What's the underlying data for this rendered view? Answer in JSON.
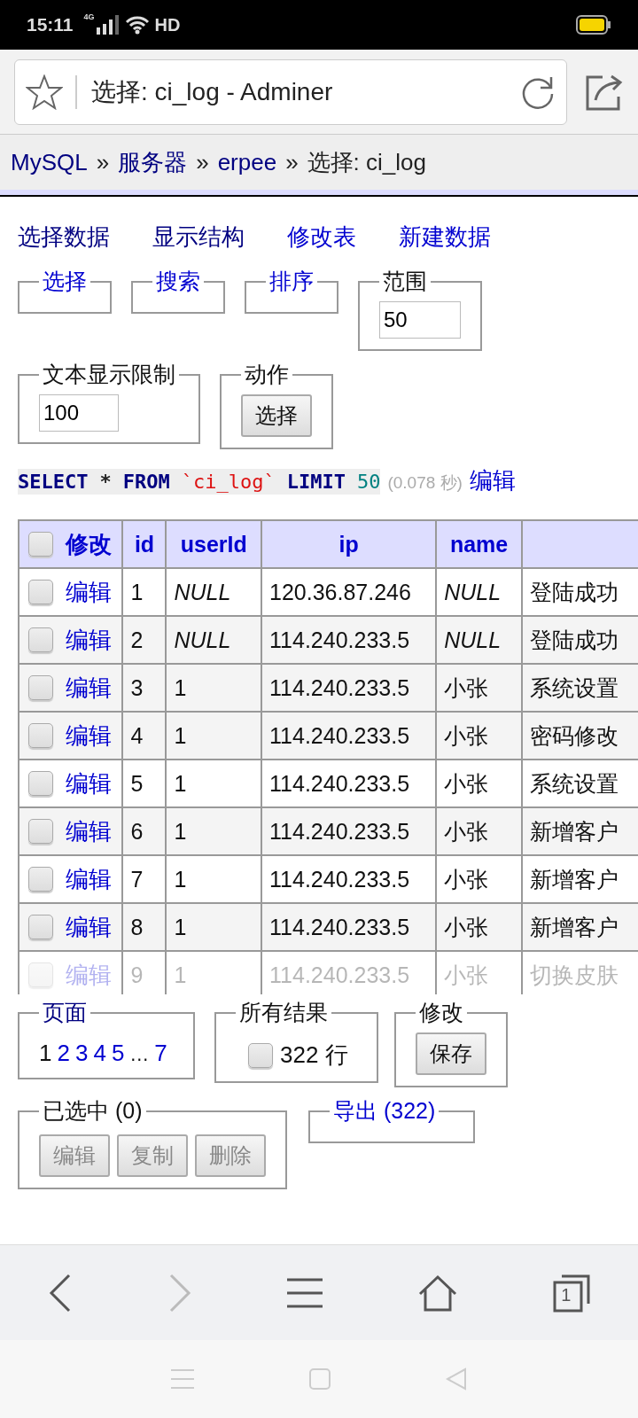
{
  "status_bar": {
    "time": "15:11",
    "network": "4G",
    "wifi_label": "HD"
  },
  "address_bar": {
    "title": "选择: ci_log - Adminer"
  },
  "breadcrumb": [
    {
      "label": "MySQL",
      "kind": "link"
    },
    {
      "label": "»",
      "kind": "separator"
    },
    {
      "label": "服务器",
      "kind": "link"
    },
    {
      "label": "»",
      "kind": "separator"
    },
    {
      "label": "erpee",
      "kind": "link"
    },
    {
      "label": "»",
      "kind": "separator"
    },
    {
      "label": "选择: ci_log",
      "kind": "current"
    }
  ],
  "tabs": [
    {
      "label": "选择数据",
      "visited": true
    },
    {
      "label": "显示结构",
      "visited": true
    },
    {
      "label": "修改表",
      "visited": false
    },
    {
      "label": "新建数据",
      "visited": false
    }
  ],
  "top_groups": [
    {
      "legend": "选择",
      "link": true
    },
    {
      "legend": "搜索",
      "link": true
    },
    {
      "legend": "排序",
      "link": true
    },
    {
      "legend": "范围",
      "link": false,
      "kind": "input",
      "value": "50"
    }
  ],
  "second_groups": [
    {
      "legend": "文本显示限制",
      "link": false,
      "kind": "input",
      "value": "100"
    },
    {
      "legend": "动作",
      "link": false,
      "kind": "button",
      "button": "选择"
    }
  ],
  "query": {
    "tokens": [
      {
        "text": "SELECT",
        "kind": "keyword"
      },
      {
        "text": "*",
        "kind": "plain"
      },
      {
        "text": "FROM",
        "kind": "keyword"
      },
      {
        "text": "`ci_log`",
        "kind": "string"
      },
      {
        "text": "LIMIT",
        "kind": "keyword"
      },
      {
        "text": "50",
        "kind": "number"
      }
    ],
    "time": "(0.078 秒)",
    "edit_link": "编辑"
  },
  "table": {
    "header_checked": false,
    "action_header": "修改",
    "columns": [
      "id",
      "userId",
      "ip",
      "name"
    ],
    "rows": [
      {
        "checked": false,
        "faded": false,
        "action": "编辑",
        "cells": [
          {
            "text": "1",
            "kind": "text"
          },
          {
            "text": "NULL",
            "kind": "null"
          },
          {
            "text": "120.36.87.246",
            "kind": "text"
          },
          {
            "text": "NULL",
            "kind": "null"
          },
          {
            "text": "登陆成功",
            "kind": "text"
          }
        ]
      },
      {
        "checked": false,
        "faded": false,
        "action": "编辑",
        "cells": [
          {
            "text": "2",
            "kind": "text"
          },
          {
            "text": "NULL",
            "kind": "null"
          },
          {
            "text": "114.240.233.5",
            "kind": "text"
          },
          {
            "text": "NULL",
            "kind": "null"
          },
          {
            "text": "登陆成功",
            "kind": "text"
          }
        ]
      },
      {
        "checked": false,
        "faded": false,
        "action": "编辑",
        "cells": [
          {
            "text": "3",
            "kind": "text"
          },
          {
            "text": "1",
            "kind": "text"
          },
          {
            "text": "114.240.233.5",
            "kind": "text"
          },
          {
            "text": "小张",
            "kind": "text"
          },
          {
            "text": "系统设置",
            "kind": "text"
          }
        ]
      },
      {
        "checked": false,
        "faded": false,
        "action": "编辑",
        "cells": [
          {
            "text": "4",
            "kind": "text"
          },
          {
            "text": "1",
            "kind": "text"
          },
          {
            "text": "114.240.233.5",
            "kind": "text"
          },
          {
            "text": "小张",
            "kind": "text"
          },
          {
            "text": "密码修改",
            "kind": "text"
          }
        ]
      },
      {
        "checked": false,
        "faded": false,
        "action": "编辑",
        "cells": [
          {
            "text": "5",
            "kind": "text"
          },
          {
            "text": "1",
            "kind": "text"
          },
          {
            "text": "114.240.233.5",
            "kind": "text"
          },
          {
            "text": "小张",
            "kind": "text"
          },
          {
            "text": "系统设置",
            "kind": "text"
          }
        ]
      },
      {
        "checked": false,
        "faded": false,
        "action": "编辑",
        "cells": [
          {
            "text": "6",
            "kind": "text"
          },
          {
            "text": "1",
            "kind": "text"
          },
          {
            "text": "114.240.233.5",
            "kind": "text"
          },
          {
            "text": "小张",
            "kind": "text"
          },
          {
            "text": "新增客户",
            "kind": "text"
          }
        ]
      },
      {
        "checked": false,
        "faded": false,
        "action": "编辑",
        "cells": [
          {
            "text": "7",
            "kind": "text"
          },
          {
            "text": "1",
            "kind": "text"
          },
          {
            "text": "114.240.233.5",
            "kind": "text"
          },
          {
            "text": "小张",
            "kind": "text"
          },
          {
            "text": "新增客户",
            "kind": "text"
          }
        ]
      },
      {
        "checked": false,
        "faded": false,
        "action": "编辑",
        "cells": [
          {
            "text": "8",
            "kind": "text"
          },
          {
            "text": "1",
            "kind": "text"
          },
          {
            "text": "114.240.233.5",
            "kind": "text"
          },
          {
            "text": "小张",
            "kind": "text"
          },
          {
            "text": "新增客户",
            "kind": "text"
          }
        ]
      },
      {
        "checked": false,
        "faded": true,
        "action": "编辑",
        "cells": [
          {
            "text": "9",
            "kind": "text"
          },
          {
            "text": "1",
            "kind": "text"
          },
          {
            "text": "114.240.233.5",
            "kind": "text"
          },
          {
            "text": "小张",
            "kind": "text"
          },
          {
            "text": "切换皮肤",
            "kind": "text"
          }
        ]
      }
    ]
  },
  "pages": {
    "legend": "页面",
    "items": [
      {
        "label": "1",
        "selected": true,
        "kind": "page"
      },
      {
        "label": "2",
        "selected": false,
        "kind": "page"
      },
      {
        "label": "3",
        "selected": false,
        "kind": "page"
      },
      {
        "label": "4",
        "selected": false,
        "kind": "page"
      },
      {
        "label": "5",
        "selected": false,
        "kind": "page"
      },
      {
        "label": "…",
        "kind": "gap"
      },
      {
        "label": "7",
        "selected": false,
        "kind": "page"
      }
    ]
  },
  "all_results": {
    "legend": "所有结果",
    "checked": false,
    "label": "322 行"
  },
  "modify": {
    "legend": "修改",
    "button": "保存"
  },
  "selection": {
    "legend": "已选中 (0)",
    "buttons": [
      {
        "label": "编辑",
        "disabled": true
      },
      {
        "label": "复制",
        "disabled": true
      },
      {
        "label": "删除",
        "disabled": true
      }
    ]
  },
  "export": {
    "legend": "导出 (322)"
  },
  "browser_nav": {
    "back_disabled": false,
    "forward_disabled": true,
    "tab_count": "1"
  }
}
